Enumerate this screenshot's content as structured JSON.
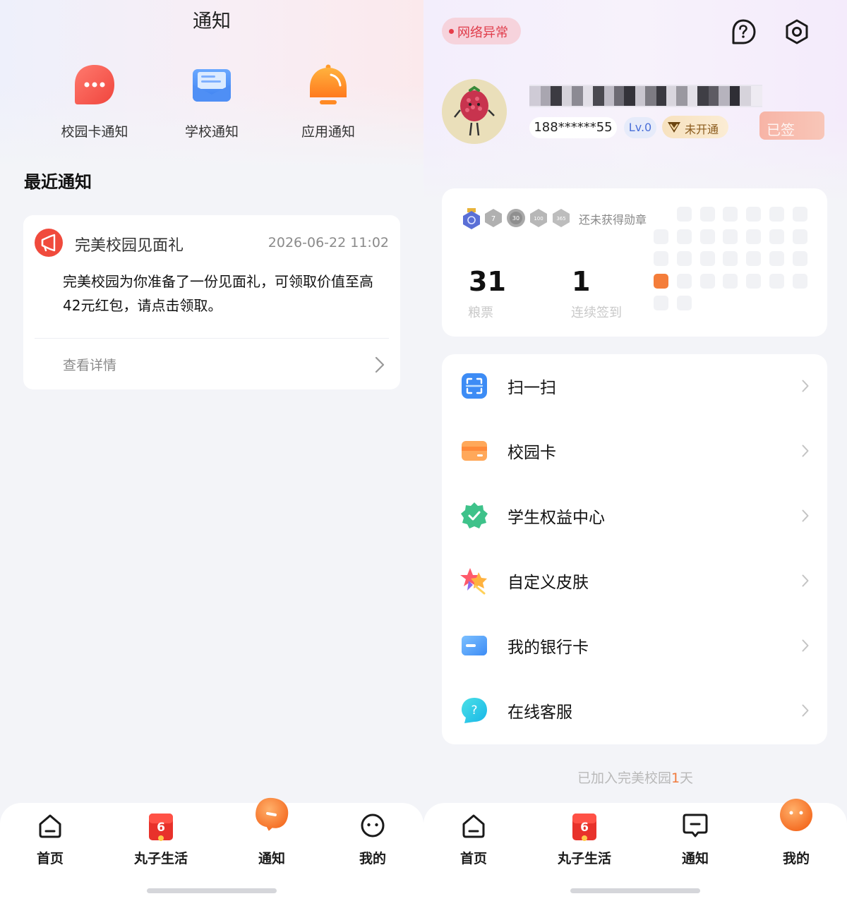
{
  "left": {
    "title": "通知",
    "categories": [
      {
        "label": "校园卡通知",
        "icon": "chat-bubble-icon"
      },
      {
        "label": "学校通知",
        "icon": "envelope-icon"
      },
      {
        "label": "应用通知",
        "icon": "bell-icon"
      }
    ],
    "recent_title": "最近通知",
    "notice": {
      "title": "完美校园见面礼",
      "time": "2026-06-22 11:02",
      "body": "完美校园为你准备了一份见面礼，可领取价值至高42元红包，请点击领取。",
      "detail_label": "查看详情"
    },
    "tabs": [
      {
        "label": "首页",
        "icon": "home-icon"
      },
      {
        "label": "丸子生活",
        "icon": "red-envelope-icon"
      },
      {
        "label": "通知",
        "icon": "notification-bubble-icon",
        "active": true
      },
      {
        "label": "我的",
        "icon": "face-icon"
      }
    ]
  },
  "right": {
    "network_status": "网络异常",
    "phone": "188******55",
    "level": "Lv.0",
    "vip_status": "未开通",
    "sign_label": "已签",
    "no_medal_text": "还未获得勋章",
    "medals": [
      {
        "text": "",
        "color": "#5a6fd6"
      },
      {
        "text": "7",
        "color": "#b0b0b0"
      },
      {
        "text": "30",
        "color": "#a9a9a9"
      },
      {
        "text": "100",
        "color": "#b7b7b7"
      },
      {
        "text": "365",
        "color": "#bdbdbd"
      }
    ],
    "stats": [
      {
        "value": "31",
        "label": "粮票"
      },
      {
        "value": "1",
        "label": "连续签到"
      }
    ],
    "calendar_checked_index": 21,
    "menu": [
      {
        "label": "扫一扫",
        "icon": "scan-icon"
      },
      {
        "label": "校园卡",
        "icon": "campus-card-icon"
      },
      {
        "label": "学生权益中心",
        "icon": "verified-badge-icon"
      },
      {
        "label": "自定义皮肤",
        "icon": "skin-star-icon"
      },
      {
        "label": "我的银行卡",
        "icon": "bank-card-icon"
      },
      {
        "label": "在线客服",
        "icon": "help-chat-icon"
      }
    ],
    "joined_prefix": "已加入完美校园",
    "joined_days": "1",
    "joined_suffix": "天",
    "tabs": [
      {
        "label": "首页",
        "icon": "home-icon"
      },
      {
        "label": "丸子生活",
        "icon": "red-envelope-icon"
      },
      {
        "label": "通知",
        "icon": "message-icon"
      },
      {
        "label": "我的",
        "icon": "face-icon",
        "active": true
      }
    ]
  },
  "colors": {
    "accent_orange": "#f47d3a",
    "alert_red": "#e63d4a",
    "level_blue": "#4a6fd8"
  }
}
